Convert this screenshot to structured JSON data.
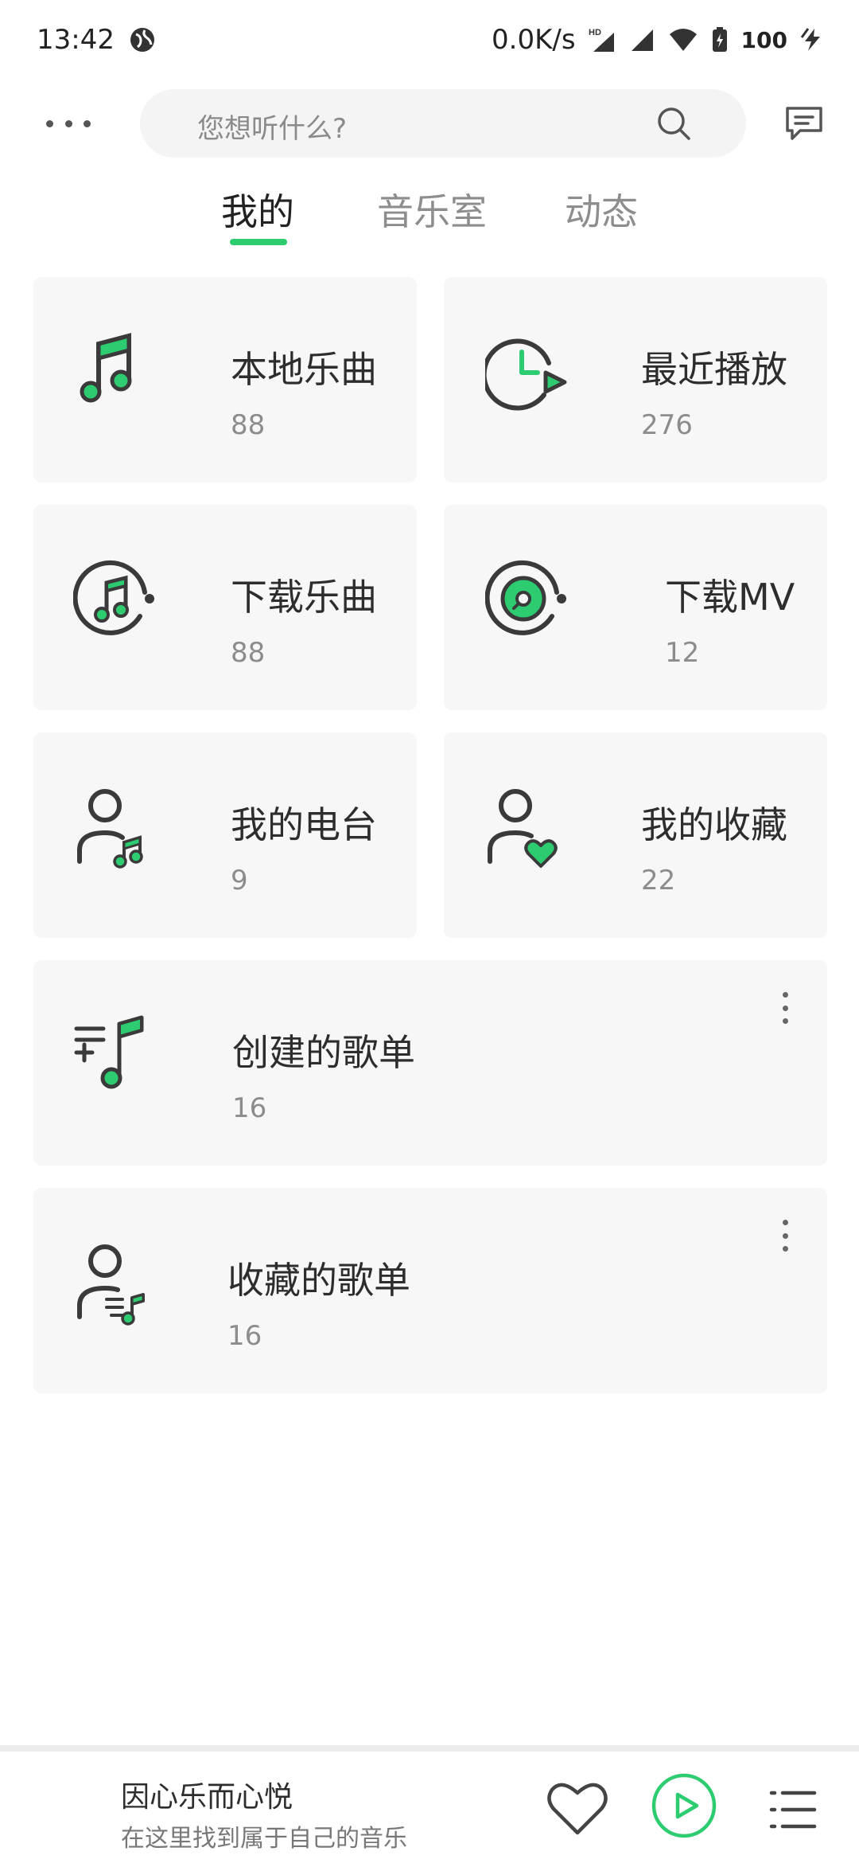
{
  "status": {
    "time": "13:42",
    "net_speed": "0.0K/s",
    "hd": "HD",
    "battery": "100"
  },
  "search": {
    "placeholder": "您想听什么?"
  },
  "tabs": [
    {
      "label": "我的",
      "active": true
    },
    {
      "label": "音乐室",
      "active": false
    },
    {
      "label": "动态",
      "active": false
    }
  ],
  "cards": {
    "local": {
      "title": "本地乐曲",
      "count": "88",
      "icon": "music-note-icon"
    },
    "recent": {
      "title": "最近播放",
      "count": "276",
      "icon": "clock-play-icon"
    },
    "download_songs": {
      "title": "下载乐曲",
      "count": "88",
      "icon": "download-music-icon"
    },
    "download_mv": {
      "title": "下载MV",
      "count": "12",
      "icon": "download-disc-icon"
    },
    "radio": {
      "title": "我的电台",
      "count": "9",
      "icon": "user-music-icon"
    },
    "favorites": {
      "title": "我的收藏",
      "count": "22",
      "icon": "user-heart-icon"
    },
    "created_playlists": {
      "title": "创建的歌单",
      "count": "16",
      "icon": "playlist-add-icon"
    },
    "collected_playlists": {
      "title": "收藏的歌单",
      "count": "16",
      "icon": "user-playlist-icon"
    }
  },
  "player": {
    "title": "因心乐而心悦",
    "subtitle": "在这里找到属于自己的音乐"
  },
  "colors": {
    "accent": "#2ecc71",
    "card_bg": "#f7f7f7",
    "icon_stroke": "#3a3a3a"
  }
}
